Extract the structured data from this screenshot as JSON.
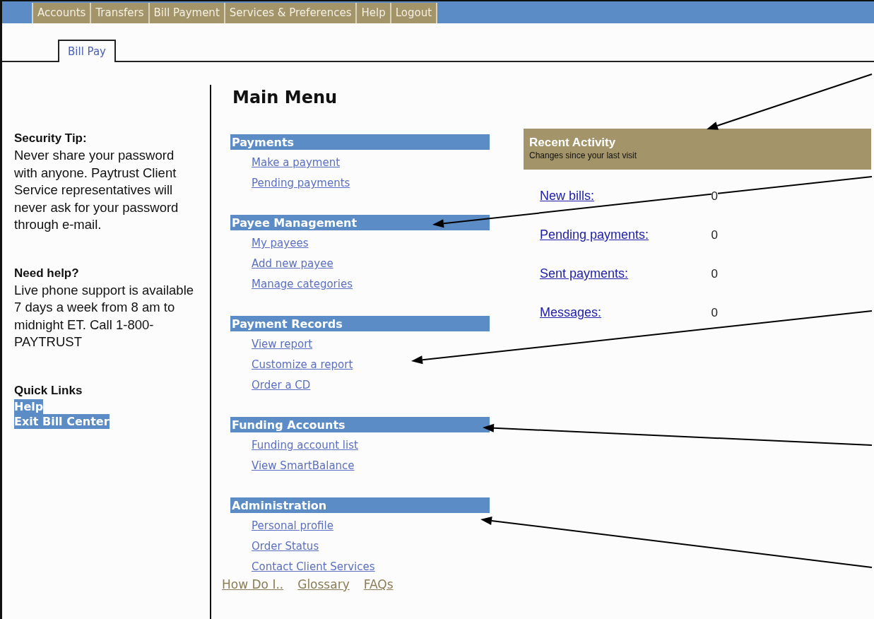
{
  "top_nav": [
    {
      "label": "Accounts"
    },
    {
      "label": "Transfers"
    },
    {
      "label": "Bill Payment"
    },
    {
      "label": "Services & Preferences"
    },
    {
      "label": "Help"
    },
    {
      "label": "Logout"
    }
  ],
  "tabs": [
    {
      "label": "Bill Pay",
      "selected": true
    }
  ],
  "sidebar": {
    "blocks": [
      {
        "title": "Security Tip:",
        "text": "Never share your password with anyone. Paytrust Client Service representatives will never ask for your password through e-mail."
      },
      {
        "title": "Need help?",
        "text": "Live phone support is available 7 days a week from 8 am to midnight ET. Call 1-800-PAYTRUST"
      }
    ],
    "quick_links": {
      "title": "Quick Links",
      "links": [
        {
          "label": "Help",
          "highlighted": true
        },
        {
          "label": "Exit Bill Center",
          "highlighted": true
        }
      ]
    }
  },
  "main_menu": {
    "title": "Main Menu",
    "sections": [
      {
        "title": "Payments",
        "links": [
          "Make a payment",
          "Pending payments"
        ]
      },
      {
        "title": "Payee Management",
        "links": [
          "My payees",
          "Add new payee",
          "Manage categories"
        ]
      },
      {
        "title": "Payment Records",
        "links": [
          "View report",
          "Customize a report",
          "Order a CD"
        ]
      },
      {
        "title": "Funding Accounts",
        "links": [
          "Funding account list",
          "View SmartBalance"
        ]
      },
      {
        "title": "Administration",
        "links": [
          "Personal profile",
          "Order Status",
          "Contact Client Services"
        ]
      }
    ],
    "footer_links": [
      "How Do I..",
      "Glossary",
      "FAQs"
    ]
  },
  "recent_activity": {
    "title": "Recent Activity",
    "subtitle": "Changes since your last visit",
    "rows": [
      {
        "label": "New bills:",
        "value": "0"
      },
      {
        "label": "Pending payments:",
        "value": "0"
      },
      {
        "label": "Sent payments:",
        "value": "0"
      },
      {
        "label": "Messages:",
        "value": "0"
      }
    ]
  }
}
